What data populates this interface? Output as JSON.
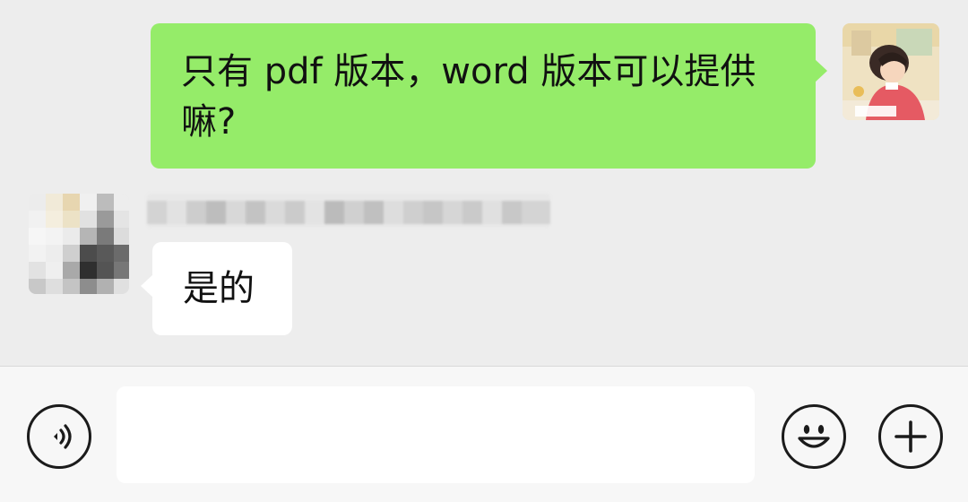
{
  "messages": {
    "outgoing": {
      "text": "只有 pdf 版本，word 版本可以提供嘛?",
      "bubble_color": "#95ec69"
    },
    "incoming": {
      "text": "是的",
      "bubble_color": "#ffffff"
    }
  },
  "input_bar": {
    "text_value": "",
    "icons": {
      "voice": "voice-icon",
      "emoji": "emoji-icon",
      "more": "plus-icon"
    }
  },
  "colors": {
    "background": "#ededed",
    "input_bar_bg": "#f7f7f7",
    "icon_stroke": "#1b1b1b"
  }
}
